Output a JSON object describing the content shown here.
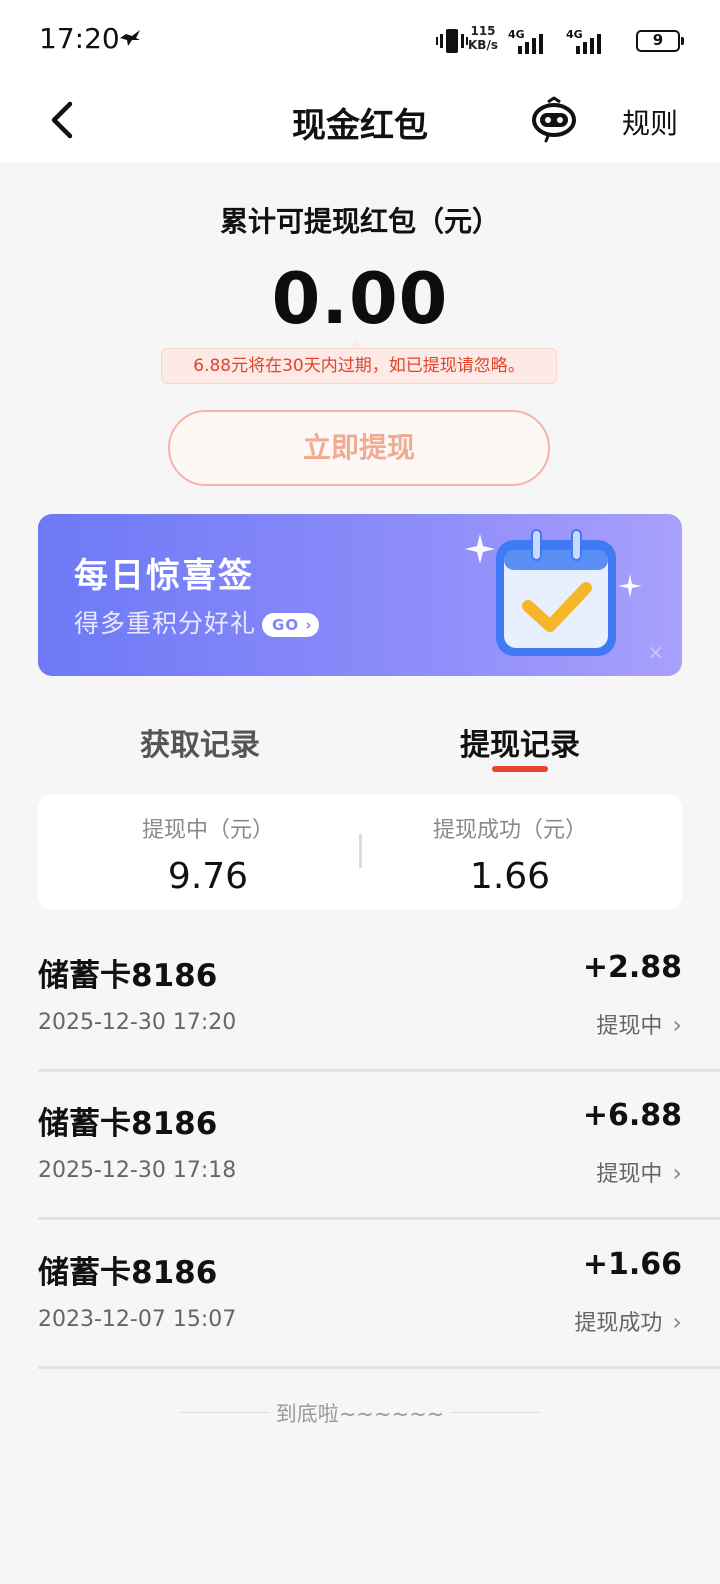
{
  "status_bar": {
    "time": "17:20",
    "net_speed_value": "115",
    "net_speed_unit": "KB/s",
    "signal_1": "4G",
    "signal_2": "4G",
    "battery": "9"
  },
  "header": {
    "title": "现金红包",
    "rules_label": "规则"
  },
  "balance": {
    "label": "累计可提现红包（元）",
    "amount": "0.00",
    "expiry_note": "6.88元将在30天内过期，如已提现请忽略。",
    "withdraw_button": "立即提现"
  },
  "promo": {
    "title": "每日惊喜签",
    "subtitle": "得多重积分好礼",
    "go_label": "GO",
    "close_label": "×"
  },
  "tabs": [
    {
      "label": "获取记录",
      "active": false
    },
    {
      "label": "提现记录",
      "active": true
    }
  ],
  "summary": {
    "pending_label": "提现中（元）",
    "pending_value": "9.76",
    "success_label": "提现成功（元）",
    "success_value": "1.66"
  },
  "records": [
    {
      "title": "储蓄卡8186",
      "time": "2025-12-30 17:20",
      "amount": "+2.88",
      "status": "提现中"
    },
    {
      "title": "储蓄卡8186",
      "time": "2025-12-30 17:18",
      "amount": "+6.88",
      "status": "提现中"
    },
    {
      "title": "储蓄卡8186",
      "time": "2023-12-07 15:07",
      "amount": "+1.66",
      "status": "提现成功"
    }
  ],
  "footer": {
    "end_text": "到底啦~~~~~~"
  },
  "colors": {
    "accent_red": "#e9452c",
    "promo_start": "#6d79f6",
    "promo_end": "#a8a0fb",
    "button_border": "#f2b6a4"
  }
}
